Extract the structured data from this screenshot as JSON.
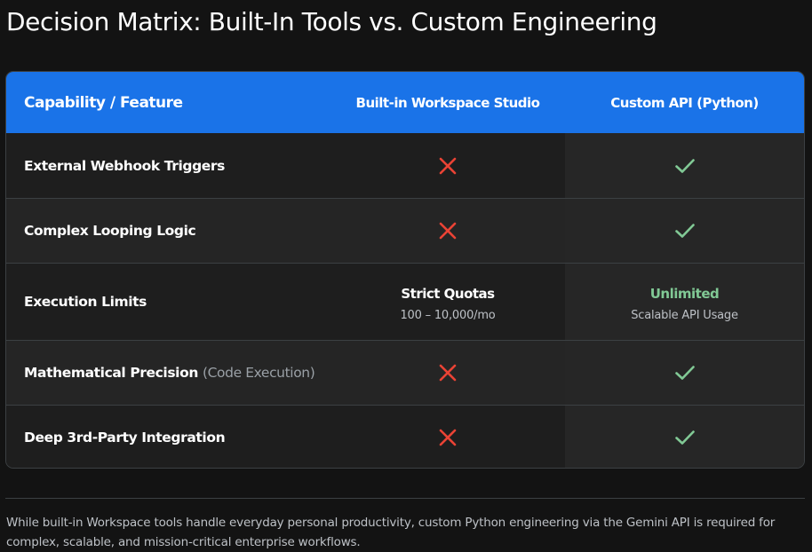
{
  "title": "Decision Matrix: Built-In Tools vs. Custom Engineering",
  "table": {
    "headers": {
      "feature": "Capability / Feature",
      "builtin": "Built-in Workspace Studio",
      "custom": "Custom API (Python)"
    },
    "rows": [
      {
        "feature": "External Webhook Triggers",
        "builtin_icon": "cross-icon",
        "custom_icon": "check-icon"
      },
      {
        "feature": "Complex Looping Logic",
        "builtin_icon": "cross-icon",
        "custom_icon": "check-icon"
      },
      {
        "feature": "Execution Limits",
        "builtin": {
          "value": "Strict Quotas",
          "detail": "100 – 10,000/mo"
        },
        "custom": {
          "value": "Unlimited",
          "detail": "Scalable API Usage"
        }
      },
      {
        "feature": "Mathematical Precision",
        "feature_note": "(Code Execution)",
        "builtin_icon": "cross-icon",
        "custom_icon": "check-icon"
      },
      {
        "feature": "Deep 3rd-Party Integration",
        "builtin_icon": "cross-icon",
        "custom_icon": "check-icon"
      }
    ]
  },
  "footnote": "While built-in Workspace tools handle everyday personal productivity, custom Python engineering via the Gemini API is required for complex, scalable, and mission-critical enterprise workflows.",
  "colors": {
    "header_bg": "#1a73e8",
    "cross": "#ea4335",
    "check": "#81c995",
    "page_bg": "#131313"
  }
}
